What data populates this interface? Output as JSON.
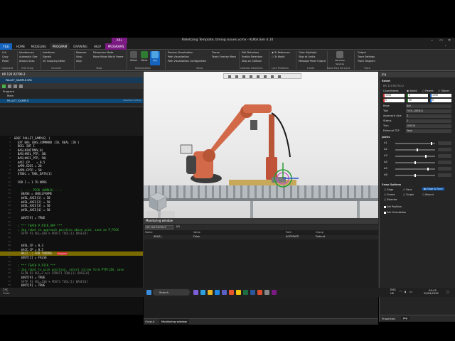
{
  "window": {
    "ctx_tab": "KRL",
    "title": "Palletizing Template, timing issues.vcmx - KUKA.Sim 4.10",
    "controls": [
      "‒",
      "▭",
      "✕"
    ]
  },
  "tabs": [
    "FILE",
    "HOME",
    "MODELING",
    "PROGRAM",
    "DRAWING",
    "HELP",
    "PROGRAMS"
  ],
  "ribbon": {
    "clipboard": {
      "items": [
        "Cut",
        "Copy",
        "Paste"
      ],
      "label": "Clipboard"
    },
    "gridsnap": {
      "items": [
        "Interference",
        "Automatic Size",
        "Always Snap"
      ],
      "label": "Grid Snap"
    },
    "connect": {
      "items": [
        "Interfaces",
        "Signals",
        "I/O mapping editor"
      ],
      "label": "Connect"
    },
    "tools": {
      "items": [
        "Measure",
        "Snap",
        "Align",
        "Dimension Mode",
        "Move Robot World Frame"
      ],
      "label": "Tools"
    },
    "manipulation": {
      "buttons": [
        "Select",
        "Move",
        "Jog"
      ],
      "label": "Manipulation"
    },
    "show": {
      "items": [
        "Process Visualization",
        "Path Visualization",
        "Path Visualization Configuration"
      ],
      "label": "Show"
    },
    "traces": {
      "items": [
        "Traces",
        "Teach Overlay Menu"
      ]
    },
    "collision": {
      "items": [
        "Edit Detectors",
        "Enable Detectors",
        "Stop on Collision"
      ],
      "label": "Collision Detection"
    },
    "lock": {
      "items": [
        "To Reference",
        "To World"
      ],
      "label": "Lock Positions"
    },
    "limits": {
      "items": [
        "Color Highlight",
        "Stop at Limits",
        "Message Panel Output"
      ],
      "label": "Limits"
    },
    "kuka": {
      "items": [
        "Start Stop Services"
      ],
      "label": "Kuka Step Services"
    },
    "trace": {
      "items": [
        "Output",
        "Trace Settings",
        "Trace Diagram"
      ],
      "label": "Trace"
    }
  },
  "program_panel": {
    "header": "KR 120 R2700-2",
    "tab": "PALLET_SAMPLE.SRC",
    "tree": {
      "program": "Program",
      "main": "Main",
      "pallet": "PALLET_SAMPLE",
      "pallet_badge": "Selected routine"
    }
  },
  "code": [
    {
      "n": "1",
      "t": "&DEF PALLET_SAMPLE( )",
      "c": ""
    },
    {
      "n": "2",
      "t": "  EXT BAS (BAS_COMMAND :IN, REAL :IN )",
      "c": ""
    },
    {
      "n": "3",
      "t": "  DECL INT I",
      "c": ""
    },
    {
      "n": "4",
      "t": "  BAS(#INITMOV,0)",
      "c": ""
    },
    {
      "n": "5",
      "t": "  BAS(#VEL_PTP, 30)",
      "c": ""
    },
    {
      "n": "6",
      "t": "  BAS(#ACC_PTP, 50)",
      "c": ""
    },
    {
      "n": "7",
      "t": "  $ACC.CP    = 0.5",
      "c": ""
    },
    {
      "n": "8",
      "t": "  $APO.CDIS = 20",
      "c": ""
    },
    {
      "n": "9",
      "t": "  $APO.CPTP = 50",
      "c": ""
    },
    {
      "n": "10",
      "t": "  $TOOL = TOOL_DATA[1]",
      "c": ""
    },
    {
      "n": "11",
      "t": "",
      "c": ""
    },
    {
      "n": "12",
      "t": "  FOR I = 1 TO NPOS",
      "c": ""
    },
    {
      "n": "13",
      "t": "",
      "c": ""
    },
    {
      "n": "14",
      "t": "    ; ---- PICK (WORLD) ----",
      "c": "cmt"
    },
    {
      "n": "15",
      "t": "    $BASE = $NULLFRAME",
      "c": ""
    },
    {
      "n": "16",
      "t": "    $VEL_AXIS[1] = 50",
      "c": ""
    },
    {
      "n": "17",
      "t": "    $VEL_AXIS[2] = 50",
      "c": ""
    },
    {
      "n": "18",
      "t": "    $VEL_AXIS[3] = 50",
      "c": ""
    },
    {
      "n": "19",
      "t": "    $VEL_AXIS[4] = 50",
      "c": ""
    },
    {
      "n": "20",
      "t": "",
      "c": ""
    },
    {
      "n": "21",
      "t": "    $OUT[9] = TRUE",
      "c": ""
    },
    {
      "n": "22",
      "t": "",
      "c": ""
    },
    {
      "n": "23",
      "t": "  ; *** TEACH P_PICK_APP ***",
      "c": "cmt"
    },
    {
      "n": "24",
      "t": "  ; Jog robot to approach position above pick, save as P_PICK",
      "c": "cmt"
    },
    {
      "n": "25",
      "t": "    SPTP P1 VEL=100 % PDAT1 TOOL[1] BASE[0]",
      "c": "dim"
    },
    {
      "n": "26",
      "t": "",
      "c": ""
    },
    {
      "n": "27",
      "t": "",
      "c": ""
    },
    {
      "n": "28",
      "t": "    $VEL.CP = 0.3",
      "c": ""
    },
    {
      "n": "29",
      "t": "    $ACC.CP = 0.5",
      "c": ""
    },
    {
      "n": "30",
      "t": "    HALT  ; FOR TUNING",
      "c": "hl"
    },
    {
      "n": "31",
      "t": "    $OUT[2] = FALSE",
      "c": ""
    },
    {
      "n": "32",
      "t": "",
      "c": ""
    },
    {
      "n": "33",
      "t": "  ; *** TEACH P_PICK ***",
      "c": "cmt"
    },
    {
      "n": "34",
      "t": "  ; Jog robot to pick position, select inline form PTP/LIN, save",
      "c": "cmt"
    },
    {
      "n": "35",
      "t": "    SLIN P2 VEL=2 m/s CPDAT1 TOOL[1] BASE[0]",
      "c": "dim"
    },
    {
      "n": "36",
      "t": "    $OUT[9] = TRUE",
      "c": ""
    },
    {
      "n": "37",
      "t": "    SPTP P3 VEL=100 % PDAT2 TOOL[1] BASE[0]",
      "c": "dim"
    },
    {
      "n": "38",
      "t": "    $OUT[9] = TRUE",
      "c": ""
    }
  ],
  "halt_badge": "Stopped",
  "monitor": {
    "title": "Monitoring window",
    "robot_select": "KR 120 R2700-2",
    "io_label": "I/O",
    "columns": [
      "Name",
      "Value",
      "Path",
      "Group"
    ],
    "row": {
      "name": "$IN[1]",
      "value": "False",
      "path": "$OPERATE",
      "group": "Default"
    },
    "tabs": [
      "Output",
      "Monitoring window"
    ]
  },
  "jog": {
    "title": "Jog",
    "robot_section": "Robot",
    "robot_name": "KR 120 R2700-2",
    "coord_label": "Coordinates",
    "coord_opts": [
      "World",
      "Parent",
      "Object"
    ],
    "xyz": [
      "1350",
      "0",
      "1590"
    ],
    "abc": [
      "0",
      "90",
      "0"
    ],
    "base_label": "Base",
    "base_val": "Null",
    "tool_label": "Tool",
    "tool_val": "TOOL_DATA[1]",
    "approach_label": "Approach Axis",
    "approach_val": "Z",
    "status_label": "Status",
    "status_val": "2",
    "turn_label": "Turn",
    "turn_val": "100010",
    "ext_label": "External TCP",
    "ext_val": "False",
    "joints_title": "Joints",
    "joints": [
      "A1",
      "A2",
      "A3",
      "A4",
      "A5",
      "A6"
    ],
    "joint_levels": [
      0.92,
      0.55,
      0.78,
      0.5,
      0.83,
      0.5
    ],
    "snap_title": "Snap Options",
    "snap": [
      "Edge",
      "Face",
      "Edge & Face",
      "Frame",
      "Origin",
      "Bound",
      "Bisector"
    ],
    "set_position": "Set Position",
    "set_orientation": "Set Orientation",
    "bottom_tabs": [
      "Properties",
      "Jog"
    ]
  },
  "taskbar": {
    "weather_temp": "7°C",
    "weather_desc": "Clear",
    "search": "Search",
    "lang": "ENG",
    "region": "UK",
    "time": "09:45",
    "date": "20/04/2026"
  },
  "colors": {
    "accent": "#1565c0",
    "program_purple": "#7a1a82",
    "comment_green": "#3cc43c",
    "robot_orange": "#d26a4a"
  }
}
